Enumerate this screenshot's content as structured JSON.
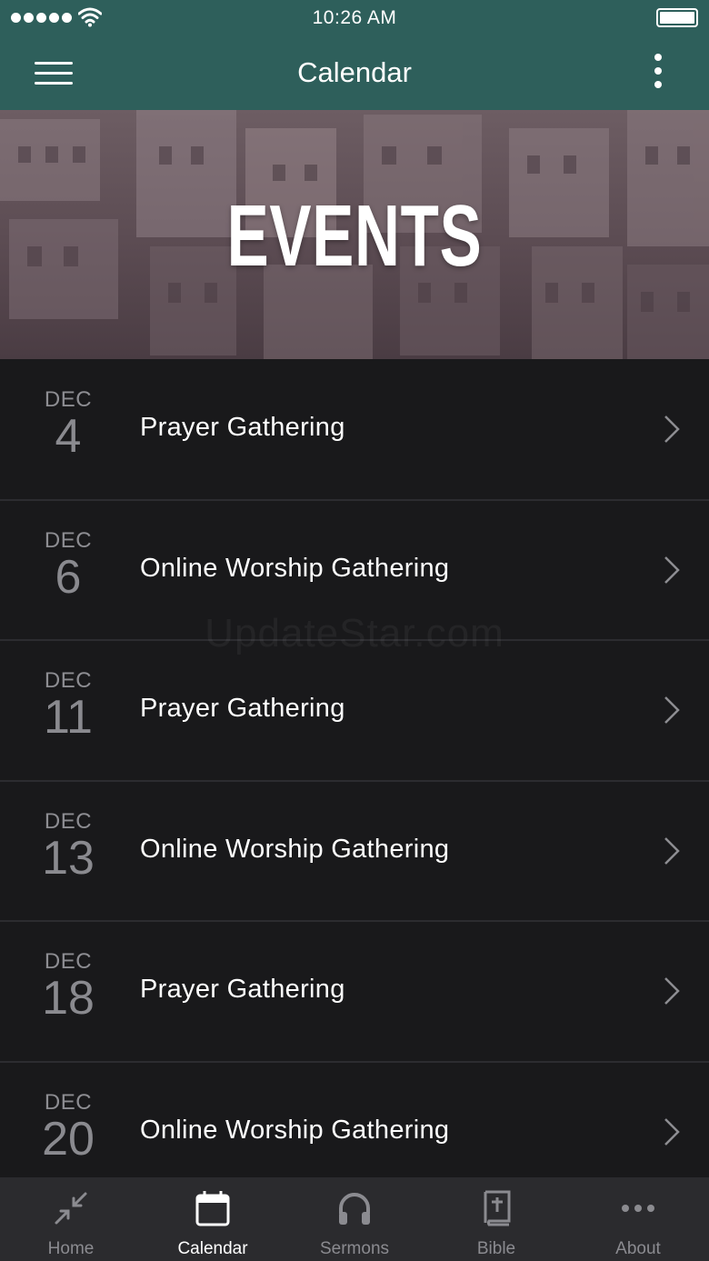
{
  "status_bar": {
    "time": "10:26 AM"
  },
  "nav": {
    "title": "Calendar"
  },
  "hero": {
    "title": "EVENTS"
  },
  "watermark": "UpdateStar.com",
  "events": [
    {
      "month": "DEC",
      "day": "4",
      "title": "Prayer Gathering"
    },
    {
      "month": "DEC",
      "day": "6",
      "title": "Online Worship Gathering"
    },
    {
      "month": "DEC",
      "day": "11",
      "title": "Prayer Gathering"
    },
    {
      "month": "DEC",
      "day": "13",
      "title": "Online Worship Gathering"
    },
    {
      "month": "DEC",
      "day": "18",
      "title": "Prayer Gathering"
    },
    {
      "month": "DEC",
      "day": "20",
      "title": "Online Worship Gathering"
    }
  ],
  "tabs": [
    {
      "label": "Home",
      "icon": "collapse-arrows-icon",
      "active": false
    },
    {
      "label": "Calendar",
      "icon": "calendar-icon",
      "active": true
    },
    {
      "label": "Sermons",
      "icon": "headphones-icon",
      "active": false
    },
    {
      "label": "Bible",
      "icon": "bible-icon",
      "active": false
    },
    {
      "label": "About",
      "icon": "more-dots-icon",
      "active": false
    }
  ],
  "colors": {
    "nav_bg": "#2e5f5b",
    "list_bg": "#19191b",
    "tab_bar_bg": "#2b2b2e",
    "inactive_tab": "#8b8b90"
  }
}
